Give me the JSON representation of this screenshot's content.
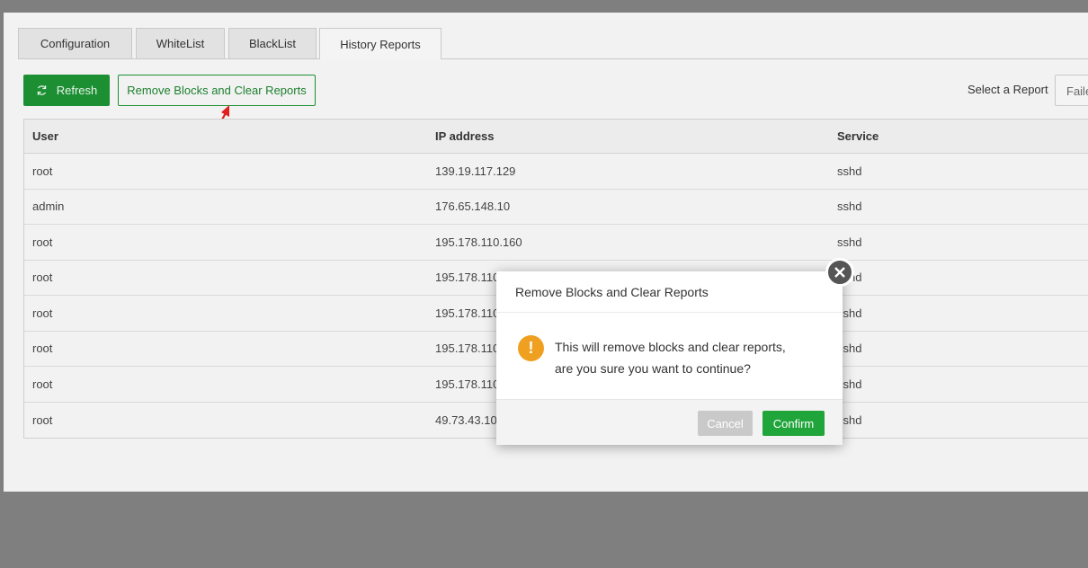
{
  "tabs": [
    {
      "label": "Configuration"
    },
    {
      "label": "WhiteList"
    },
    {
      "label": "BlackList"
    },
    {
      "label": "History Reports"
    }
  ],
  "toolbar": {
    "refresh_label": "Refresh",
    "remove_label": "Remove Blocks and Clear Reports",
    "select_label": "Select a Report",
    "select_value": "Failed"
  },
  "table": {
    "headers": [
      "User",
      "IP address",
      "Service"
    ],
    "rows": [
      [
        "root",
        "139.19.117.129",
        "sshd"
      ],
      [
        "admin",
        "176.65.148.10",
        "sshd"
      ],
      [
        "root",
        "195.178.110.160",
        "sshd"
      ],
      [
        "root",
        "195.178.110",
        "sshd"
      ],
      [
        "root",
        "195.178.110",
        "sshd"
      ],
      [
        "root",
        "195.178.110",
        "sshd"
      ],
      [
        "root",
        "195.178.110",
        "sshd"
      ],
      [
        "root",
        "49.73.43.104",
        "sshd"
      ]
    ]
  },
  "modal": {
    "title": "Remove Blocks and Clear Reports",
    "line1": "This will remove blocks and clear reports,",
    "line2": "are you sure you want to continue?",
    "icon": "warning-icon",
    "cancel_label": "Cancel",
    "confirm_label": "Confirm"
  },
  "colors": {
    "accent": "#20a53a",
    "warning": "#f0a020",
    "annotation_arrow": "#e0201c"
  }
}
